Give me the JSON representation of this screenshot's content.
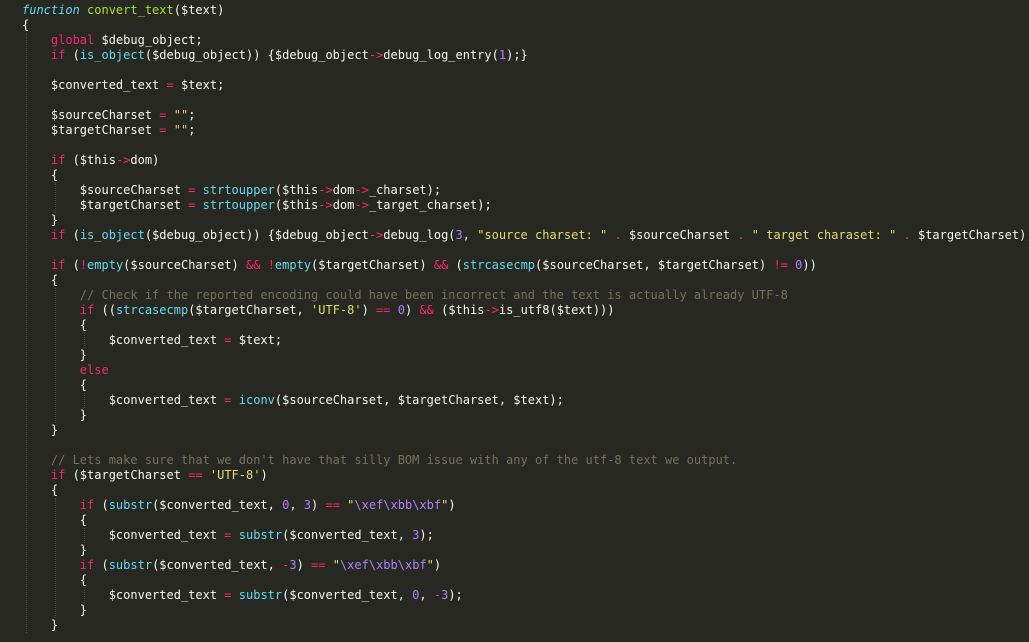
{
  "editor": {
    "theme": "monokai",
    "colors": {
      "background": "#272822",
      "keyword": "#f92672",
      "function": "#66d9ef",
      "entity": "#a6e22e",
      "string": "#e6db74",
      "number": "#ae81ff",
      "comment": "#75715e",
      "plain": "#f8f8f2"
    },
    "lines": [
      {
        "indent": 0,
        "tokens": [
          [
            "fnk",
            "function"
          ],
          [
            "pl",
            " "
          ],
          [
            "ent",
            "convert_text"
          ],
          [
            "pl",
            "("
          ],
          [
            "var",
            "$text"
          ],
          [
            "pl",
            ")"
          ]
        ]
      },
      {
        "indent": 0,
        "tokens": [
          [
            "pl",
            "{"
          ]
        ]
      },
      {
        "indent": 1,
        "tokens": [
          [
            "kw",
            "global"
          ],
          [
            "pl",
            " $debug_object;"
          ]
        ]
      },
      {
        "indent": 1,
        "tokens": [
          [
            "kw",
            "if"
          ],
          [
            "pl",
            " ("
          ],
          [
            "fn",
            "is_object"
          ],
          [
            "pl",
            "($debug_object)) {$debug_object"
          ],
          [
            "kw",
            "->"
          ],
          [
            "pl",
            "debug_log_entry("
          ],
          [
            "num",
            "1"
          ],
          [
            "pl",
            ");}"
          ]
        ]
      },
      {
        "indent": 1,
        "tokens": []
      },
      {
        "indent": 1,
        "tokens": [
          [
            "pl",
            "$converted_text "
          ],
          [
            "kw",
            "="
          ],
          [
            "pl",
            " $text;"
          ]
        ]
      },
      {
        "indent": 1,
        "tokens": []
      },
      {
        "indent": 1,
        "tokens": [
          [
            "pl",
            "$sourceCharset "
          ],
          [
            "kw",
            "="
          ],
          [
            "pl",
            " "
          ],
          [
            "str",
            "\"\""
          ],
          [
            "pl",
            ";"
          ]
        ]
      },
      {
        "indent": 1,
        "tokens": [
          [
            "pl",
            "$targetCharset "
          ],
          [
            "kw",
            "="
          ],
          [
            "pl",
            " "
          ],
          [
            "str",
            "\"\""
          ],
          [
            "pl",
            ";"
          ]
        ]
      },
      {
        "indent": 1,
        "tokens": []
      },
      {
        "indent": 1,
        "tokens": [
          [
            "kw",
            "if"
          ],
          [
            "pl",
            " ($this"
          ],
          [
            "kw",
            "->"
          ],
          [
            "pl",
            "dom)"
          ]
        ]
      },
      {
        "indent": 1,
        "tokens": [
          [
            "pl",
            "{"
          ]
        ]
      },
      {
        "indent": 2,
        "tokens": [
          [
            "pl",
            "$sourceCharset "
          ],
          [
            "kw",
            "="
          ],
          [
            "pl",
            " "
          ],
          [
            "fn",
            "strtoupper"
          ],
          [
            "pl",
            "($this"
          ],
          [
            "kw",
            "->"
          ],
          [
            "pl",
            "dom"
          ],
          [
            "kw",
            "->"
          ],
          [
            "pl",
            "_charset);"
          ]
        ]
      },
      {
        "indent": 2,
        "tokens": [
          [
            "pl",
            "$targetCharset "
          ],
          [
            "kw",
            "="
          ],
          [
            "pl",
            " "
          ],
          [
            "fn",
            "strtoupper"
          ],
          [
            "pl",
            "($this"
          ],
          [
            "kw",
            "->"
          ],
          [
            "pl",
            "dom"
          ],
          [
            "kw",
            "->"
          ],
          [
            "pl",
            "_target_charset);"
          ]
        ]
      },
      {
        "indent": 1,
        "tokens": [
          [
            "pl",
            "}"
          ]
        ]
      },
      {
        "indent": 1,
        "tokens": [
          [
            "kw",
            "if"
          ],
          [
            "pl",
            " ("
          ],
          [
            "fn",
            "is_object"
          ],
          [
            "pl",
            "($debug_object)) {$debug_object"
          ],
          [
            "kw",
            "->"
          ],
          [
            "pl",
            "debug_log("
          ],
          [
            "num",
            "3"
          ],
          [
            "pl",
            ", "
          ],
          [
            "str",
            "\"source charset: \""
          ],
          [
            "pl",
            " "
          ],
          [
            "kw",
            "."
          ],
          [
            "pl",
            " $sourceCharset "
          ],
          [
            "kw",
            "."
          ],
          [
            "pl",
            " "
          ],
          [
            "str",
            "\" target charaset: \""
          ],
          [
            "pl",
            " "
          ],
          [
            "kw",
            "."
          ],
          [
            "pl",
            " $targetCharset);}"
          ]
        ]
      },
      {
        "indent": 1,
        "tokens": []
      },
      {
        "indent": 1,
        "tokens": [
          [
            "kw",
            "if"
          ],
          [
            "pl",
            " ("
          ],
          [
            "kw",
            "!"
          ],
          [
            "fn",
            "empty"
          ],
          [
            "pl",
            "($sourceCharset) "
          ],
          [
            "kw",
            "&&"
          ],
          [
            "pl",
            " "
          ],
          [
            "kw",
            "!"
          ],
          [
            "fn",
            "empty"
          ],
          [
            "pl",
            "($targetCharset) "
          ],
          [
            "kw",
            "&&"
          ],
          [
            "pl",
            " ("
          ],
          [
            "fn",
            "strcasecmp"
          ],
          [
            "pl",
            "($sourceCharset, $targetCharset) "
          ],
          [
            "kw",
            "!="
          ],
          [
            "pl",
            " "
          ],
          [
            "num",
            "0"
          ],
          [
            "pl",
            "))"
          ]
        ]
      },
      {
        "indent": 1,
        "tokens": [
          [
            "pl",
            "{"
          ]
        ]
      },
      {
        "indent": 2,
        "tokens": [
          [
            "com",
            "// Check if the reported encoding could have been incorrect and the text is actually already UTF-8"
          ]
        ]
      },
      {
        "indent": 2,
        "tokens": [
          [
            "kw",
            "if"
          ],
          [
            "pl",
            " (("
          ],
          [
            "fn",
            "strcasecmp"
          ],
          [
            "pl",
            "($targetCharset, "
          ],
          [
            "str",
            "'UTF-8'"
          ],
          [
            "pl",
            ") "
          ],
          [
            "kw",
            "=="
          ],
          [
            "pl",
            " "
          ],
          [
            "num",
            "0"
          ],
          [
            "pl",
            ") "
          ],
          [
            "kw",
            "&&"
          ],
          [
            "pl",
            " ($this"
          ],
          [
            "kw",
            "->"
          ],
          [
            "pl",
            "is_utf8($text)))"
          ]
        ]
      },
      {
        "indent": 2,
        "tokens": [
          [
            "pl",
            "{"
          ]
        ]
      },
      {
        "indent": 3,
        "tokens": [
          [
            "pl",
            "$converted_text "
          ],
          [
            "kw",
            "="
          ],
          [
            "pl",
            " $text;"
          ]
        ]
      },
      {
        "indent": 2,
        "tokens": [
          [
            "pl",
            "}"
          ]
        ]
      },
      {
        "indent": 2,
        "tokens": [
          [
            "kw",
            "else"
          ]
        ]
      },
      {
        "indent": 2,
        "tokens": [
          [
            "pl",
            "{"
          ]
        ]
      },
      {
        "indent": 3,
        "tokens": [
          [
            "pl",
            "$converted_text "
          ],
          [
            "kw",
            "="
          ],
          [
            "pl",
            " "
          ],
          [
            "fn",
            "iconv"
          ],
          [
            "pl",
            "($sourceCharset, $targetCharset, $text);"
          ]
        ]
      },
      {
        "indent": 2,
        "tokens": [
          [
            "pl",
            "}"
          ]
        ]
      },
      {
        "indent": 1,
        "tokens": [
          [
            "pl",
            "}"
          ]
        ]
      },
      {
        "indent": 1,
        "tokens": []
      },
      {
        "indent": 1,
        "tokens": [
          [
            "com",
            "// Lets make sure that we don't have that silly BOM issue with any of the utf-8 text we output."
          ]
        ]
      },
      {
        "indent": 1,
        "tokens": [
          [
            "kw",
            "if"
          ],
          [
            "pl",
            " ($targetCharset "
          ],
          [
            "kw",
            "=="
          ],
          [
            "pl",
            " "
          ],
          [
            "str",
            "'UTF-8'"
          ],
          [
            "pl",
            ")"
          ]
        ]
      },
      {
        "indent": 1,
        "tokens": [
          [
            "pl",
            "{"
          ]
        ]
      },
      {
        "indent": 2,
        "tokens": [
          [
            "kw",
            "if"
          ],
          [
            "pl",
            " ("
          ],
          [
            "fn",
            "substr"
          ],
          [
            "pl",
            "($converted_text, "
          ],
          [
            "num",
            "0"
          ],
          [
            "pl",
            ", "
          ],
          [
            "num",
            "3"
          ],
          [
            "pl",
            ") "
          ],
          [
            "kw",
            "=="
          ],
          [
            "pl",
            " "
          ],
          [
            "str",
            "\""
          ],
          [
            "esc",
            "\\xef\\xbb\\xbf"
          ],
          [
            "str",
            "\""
          ],
          [
            "pl",
            ")"
          ]
        ]
      },
      {
        "indent": 2,
        "tokens": [
          [
            "pl",
            "{"
          ]
        ]
      },
      {
        "indent": 3,
        "tokens": [
          [
            "pl",
            "$converted_text "
          ],
          [
            "kw",
            "="
          ],
          [
            "pl",
            " "
          ],
          [
            "fn",
            "substr"
          ],
          [
            "pl",
            "($converted_text, "
          ],
          [
            "num",
            "3"
          ],
          [
            "pl",
            ");"
          ]
        ]
      },
      {
        "indent": 2,
        "tokens": [
          [
            "pl",
            "}"
          ]
        ]
      },
      {
        "indent": 2,
        "tokens": [
          [
            "kw",
            "if"
          ],
          [
            "pl",
            " ("
          ],
          [
            "fn",
            "substr"
          ],
          [
            "pl",
            "($converted_text, "
          ],
          [
            "kw",
            "-"
          ],
          [
            "num",
            "3"
          ],
          [
            "pl",
            ") "
          ],
          [
            "kw",
            "=="
          ],
          [
            "pl",
            " "
          ],
          [
            "str",
            "\""
          ],
          [
            "esc",
            "\\xef\\xbb\\xbf"
          ],
          [
            "str",
            "\""
          ],
          [
            "pl",
            ")"
          ]
        ]
      },
      {
        "indent": 2,
        "tokens": [
          [
            "pl",
            "{"
          ]
        ]
      },
      {
        "indent": 3,
        "tokens": [
          [
            "pl",
            "$converted_text "
          ],
          [
            "kw",
            "="
          ],
          [
            "pl",
            " "
          ],
          [
            "fn",
            "substr"
          ],
          [
            "pl",
            "($converted_text, "
          ],
          [
            "num",
            "0"
          ],
          [
            "pl",
            ", "
          ],
          [
            "kw",
            "-"
          ],
          [
            "num",
            "3"
          ],
          [
            "pl",
            ");"
          ]
        ]
      },
      {
        "indent": 2,
        "tokens": [
          [
            "pl",
            "}"
          ]
        ]
      },
      {
        "indent": 1,
        "tokens": [
          [
            "pl",
            "}"
          ]
        ]
      }
    ]
  }
}
